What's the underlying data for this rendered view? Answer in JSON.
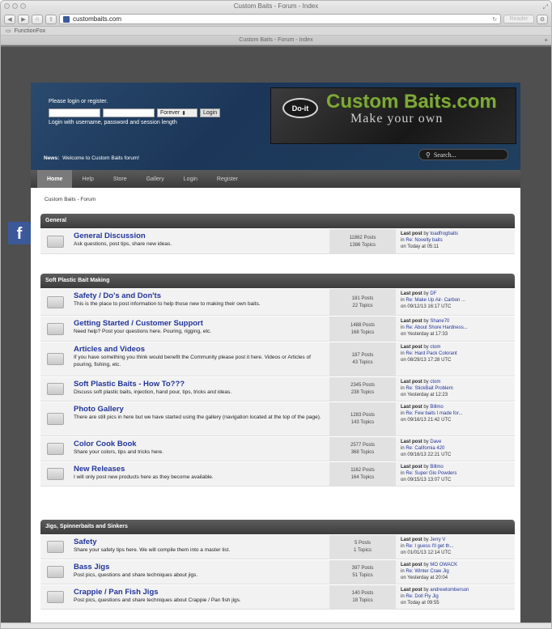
{
  "browser": {
    "window_title": "Custom Baits - Forum - Index",
    "url": "custombaits.com",
    "reader_label": "Reader",
    "bookmark": "FunctionFox",
    "tab_title": "Custom Baits - Forum - Index"
  },
  "header": {
    "login_text": "Please login or register.",
    "remember_option": "Forever",
    "login_button": "Login",
    "login_hint": "Login with username, password and session length",
    "logo_oval": "Do-it",
    "logo_main": "Custom Baits.com",
    "logo_sub": "Make your own",
    "news_label": "News:",
    "news_text": "Welcome to Custom Baits forum!",
    "search_placeholder": "Search..."
  },
  "nav": [
    "Home",
    "Help",
    "Store",
    "Gallery",
    "Login",
    "Register"
  ],
  "breadcrumb": "Custom Baits - Forum",
  "facebook_label": "f",
  "categories": [
    {
      "name": "General",
      "boards": [
        {
          "title": "General Discussion",
          "desc": "Ask questions, post tips, share new ideas.",
          "posts": "11862 Posts",
          "topics": "1386 Topics",
          "lp_by": "toadfrogbaits",
          "lp_in": "Re: Novelty baits",
          "lp_on": "Today at 05:11"
        }
      ]
    },
    {
      "name": "Soft Plastic Bait Making",
      "boards": [
        {
          "title": "Safety / Do's and Don'ts",
          "desc": "This is the place to post information to help those new to making their own baits.",
          "posts": "181 Posts",
          "topics": "22 Topics",
          "lp_by": "DF",
          "lp_in": "Re: Make Up Air- Carbon ...",
          "lp_on": "09/12/13 16:17 UTC"
        },
        {
          "title": "Getting Started / Customer Support",
          "desc": "Need help? Post your questions here. Pouring, rigging, etc.",
          "posts": "1488 Posts",
          "topics": "168 Topics",
          "lp_by": "Shane70",
          "lp_in": "Re: About Shore Hardness...",
          "lp_on": "Yesterday at 17:33"
        },
        {
          "title": "Articles and Videos",
          "desc": "If you have something you think would benefit the Community please post it here. Videos or Articles of pouring, fishing, etc.",
          "posts": "187 Posts",
          "topics": "43 Topics",
          "lp_by": "ctom",
          "lp_in": "Re: Hard Pack Colorant",
          "lp_on": "08/29/13 17:28 UTC"
        },
        {
          "title": "Soft Plastic Baits - How To???",
          "desc": "Discuss soft plastic baits, injection, hand pour, tips, tricks and ideas.",
          "posts": "2345 Posts",
          "topics": "238 Topics",
          "lp_by": "ctom",
          "lp_in": "Re: StickBait Problem",
          "lp_on": "Yesterday at 12:23"
        },
        {
          "title": "Photo Gallery",
          "desc": "There are still pics in here but we have started using the gallery (navigation located at the top of the page).",
          "posts": "1283 Posts",
          "topics": "143 Topics",
          "lp_by": "Billmo",
          "lp_in": "Re: Few baits I made for...",
          "lp_on": "09/16/13 21:42 UTC"
        },
        {
          "title": "Color Cook Book",
          "desc": "Share your colors, tips and tricks here.",
          "posts": "2577 Posts",
          "topics": "368 Topics",
          "lp_by": "Dave",
          "lp_in": "Re: California 420",
          "lp_on": "09/16/13 22:21 UTC"
        },
        {
          "title": "New Releases",
          "desc": "I will only post new products here as they become available.",
          "posts": "1162 Posts",
          "topics": "164 Topics",
          "lp_by": "Billmo",
          "lp_in": "Re: Super Glo Powders",
          "lp_on": "09/15/13 13:07 UTC"
        }
      ]
    },
    {
      "name": "Jigs, Spinnerbaits and Sinkers",
      "boards": [
        {
          "title": "Safety",
          "desc": "Share your safety tips here. We will compile them into a master list.",
          "posts": "5 Posts",
          "topics": "1 Topics",
          "lp_by": "Jerry V",
          "lp_in": "Re: I guess I'll get th...",
          "lp_on": "01/01/13 12:14 UTC"
        },
        {
          "title": "Bass Jigs",
          "desc": "Post pics, questions and share techniques about jigs.",
          "posts": "397 Posts",
          "topics": "51 Topics",
          "lp_by": "MO OWACK",
          "lp_in": "Re: Winter Craw Jig",
          "lp_on": "Yesterday at 20:04"
        },
        {
          "title": "Crappie / Pan Fish Jigs",
          "desc": "Post pics, questions and share techniques about Crappie / Pan fish jigs.",
          "posts": "140 Posts",
          "topics": "18 Topics",
          "lp_by": "andrewtomberson",
          "lp_in": "Re: Doll Fly Jig",
          "lp_on": "Today at 09:55"
        }
      ]
    }
  ],
  "labels": {
    "last_post": "Last post",
    "by": "by",
    "in": "in",
    "on": "on"
  }
}
